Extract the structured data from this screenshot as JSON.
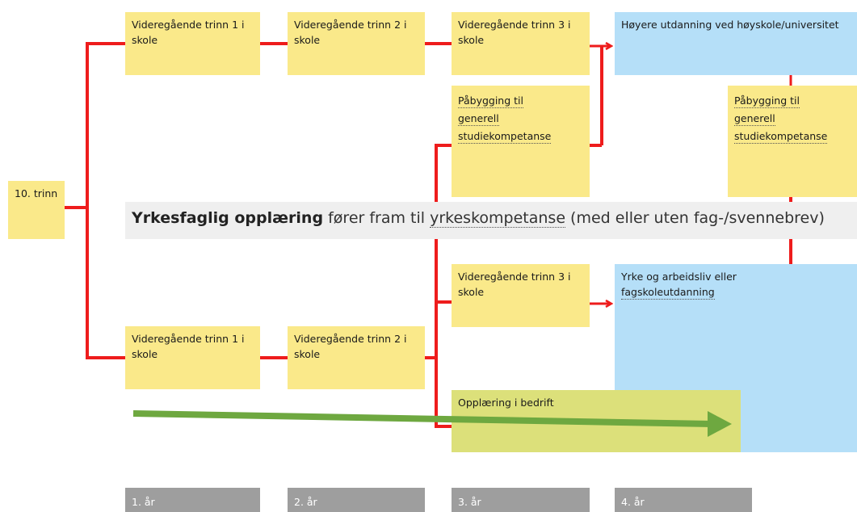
{
  "boxes": {
    "grade10": "10. trinn",
    "top_vg1": "Videregående trinn 1 i skole",
    "top_vg2": "Videregående trinn 2 i skole",
    "top_vg3": "Videregående trinn 3 i skole",
    "higher_education": "Høyere utdanning ved høyskole/universitet",
    "pabygging_left": [
      "Påbygging til",
      "generell",
      "studiekompetanse"
    ],
    "pabygging_right": [
      "Påbygging til",
      "generell",
      "studiekompetanse"
    ],
    "bottom_vg1": "Videregående trinn 1 i skole",
    "bottom_vg2": "Videregående trinn 2 i skole",
    "bottom_vg3": "Videregående trinn 3 i skole",
    "work_life": [
      "Yrke og arbeidsliv eller",
      "fagskoleutdanning"
    ],
    "apprenticeship": "Opplæring i bedrift"
  },
  "banner": {
    "bold": "Yrkesfaglig opplæring",
    "mid": " fører fram til ",
    "term": "yrkeskompetanse",
    "end": " (med eller uten fag-/svennebrev)"
  },
  "years": [
    "1. år",
    "2. år",
    "3. år",
    "4. år"
  ],
  "colors": {
    "line": "#ee1c1c",
    "yellow": "#fae98a",
    "blue": "#b5dff8",
    "olive": "#dce07a",
    "arrow_green": "#6ea840",
    "year_bar": "#9e9e9e"
  }
}
